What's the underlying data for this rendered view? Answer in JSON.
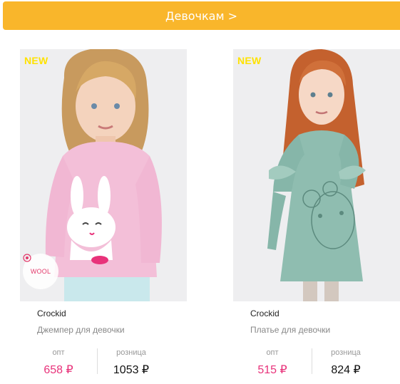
{
  "banner": {
    "label": "Девочкам >"
  },
  "products": [
    {
      "badge": "NEW",
      "wool_label": "WOOL",
      "brand": "Crockid",
      "name": "Джемпер для девочки",
      "opt_label": "опт",
      "opt_price": "658 ₽",
      "retail_label": "розница",
      "retail_price": "1053 ₽"
    },
    {
      "badge": "NEW",
      "brand": "Crockid",
      "name": "Платье для девочки",
      "opt_label": "опт",
      "opt_price": "515 ₽",
      "retail_label": "розница",
      "retail_price": "824 ₽"
    }
  ],
  "colors": {
    "banner": "#f9b62b",
    "badge": "#ffe200",
    "opt_price": "#e8327a"
  }
}
